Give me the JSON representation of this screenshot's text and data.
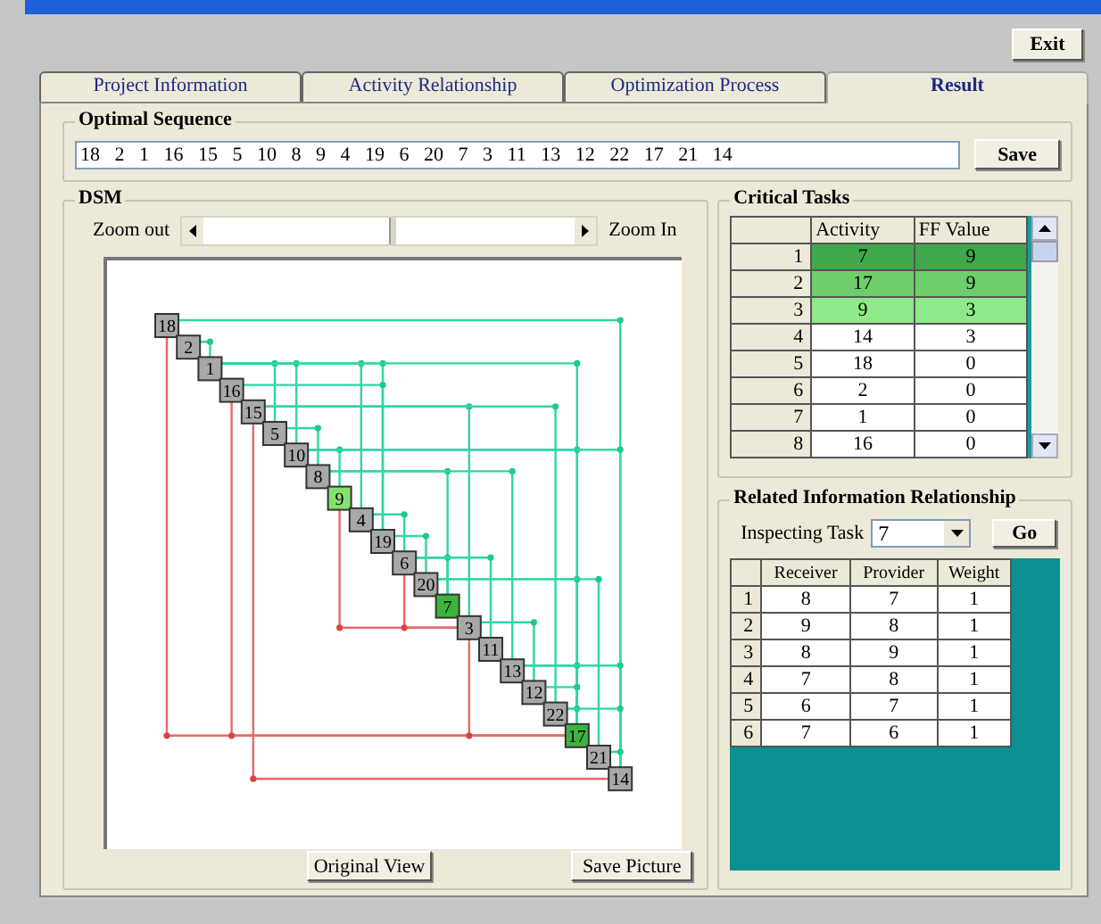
{
  "exit_button": "Exit",
  "tabs": [
    {
      "label": "Project Information",
      "selected": false
    },
    {
      "label": "Activity Relationship",
      "selected": false
    },
    {
      "label": "Optimization Process",
      "selected": false
    },
    {
      "label": "Result",
      "selected": true
    }
  ],
  "optimal_sequence": {
    "title": "Optimal Sequence",
    "value": "18   2   1   16   15   5   10   8   9   4   19   6   20   7   3   11   13   12   22   17   21   14",
    "save_button": "Save"
  },
  "dsm": {
    "title": "DSM",
    "zoom_out": "Zoom out",
    "zoom_in": "Zoom In",
    "zoom": {
      "level": 0.5
    },
    "nodes": [
      {
        "label": "18",
        "color": "#a8a8a8"
      },
      {
        "label": "2",
        "color": "#a8a8a8"
      },
      {
        "label": "1",
        "color": "#a8a8a8"
      },
      {
        "label": "16",
        "color": "#a8a8a8"
      },
      {
        "label": "15",
        "color": "#a8a8a8"
      },
      {
        "label": "5",
        "color": "#a8a8a8"
      },
      {
        "label": "10",
        "color": "#a8a8a8"
      },
      {
        "label": "8",
        "color": "#a8a8a8"
      },
      {
        "label": "9",
        "color": "#86e070"
      },
      {
        "label": "4",
        "color": "#a8a8a8"
      },
      {
        "label": "19",
        "color": "#a8a8a8"
      },
      {
        "label": "6",
        "color": "#a8a8a8"
      },
      {
        "label": "20",
        "color": "#a8a8a8"
      },
      {
        "label": "7",
        "color": "#3cb43c"
      },
      {
        "label": "3",
        "color": "#a8a8a8"
      },
      {
        "label": "11",
        "color": "#a8a8a8"
      },
      {
        "label": "13",
        "color": "#a8a8a8"
      },
      {
        "label": "12",
        "color": "#a8a8a8"
      },
      {
        "label": "22",
        "color": "#a8a8a8"
      },
      {
        "label": "17",
        "color": "#3cb43c"
      },
      {
        "label": "21",
        "color": "#a8a8a8"
      },
      {
        "label": "14",
        "color": "#a8a8a8"
      }
    ],
    "buttons": [
      "Original View",
      "Save Picture"
    ]
  },
  "critical_tasks": {
    "title": "Critical Tasks",
    "columns": [
      "Activity",
      "FF Value"
    ],
    "rows": [
      {
        "index": "1",
        "activity": "7",
        "ff_value": "9",
        "color": "#3fa84a"
      },
      {
        "index": "2",
        "activity": "17",
        "ff_value": "9",
        "color": "#6ccf6c"
      },
      {
        "index": "3",
        "activity": "9",
        "ff_value": "3",
        "color": "#8ee98a"
      },
      {
        "index": "4",
        "activity": "14",
        "ff_value": "3",
        "color": "#ffffff"
      },
      {
        "index": "5",
        "activity": "18",
        "ff_value": "0",
        "color": "#ffffff"
      },
      {
        "index": "6",
        "activity": "2",
        "ff_value": "0",
        "color": "#ffffff"
      },
      {
        "index": "7",
        "activity": "1",
        "ff_value": "0",
        "color": "#ffffff"
      },
      {
        "index": "8",
        "activity": "16",
        "ff_value": "0",
        "color": "#ffffff"
      }
    ]
  },
  "related_information": {
    "title": "Related Information Relationship",
    "inspecting_task_label": "Inspecting Task",
    "inspecting_task": "7",
    "go_button": "Go",
    "columns": [
      "Receiver",
      "Provider",
      "Weight"
    ],
    "rows": [
      {
        "index": "1",
        "receiver": "8",
        "provider": "7",
        "weight": "1"
      },
      {
        "index": "2",
        "receiver": "9",
        "provider": "8",
        "weight": "1"
      },
      {
        "index": "3",
        "receiver": "8",
        "provider": "9",
        "weight": "1"
      },
      {
        "index": "4",
        "receiver": "7",
        "provider": "8",
        "weight": "1"
      },
      {
        "index": "5",
        "receiver": "6",
        "provider": "7",
        "weight": "1"
      },
      {
        "index": "6",
        "receiver": "7",
        "provider": "6",
        "weight": "1"
      }
    ]
  }
}
